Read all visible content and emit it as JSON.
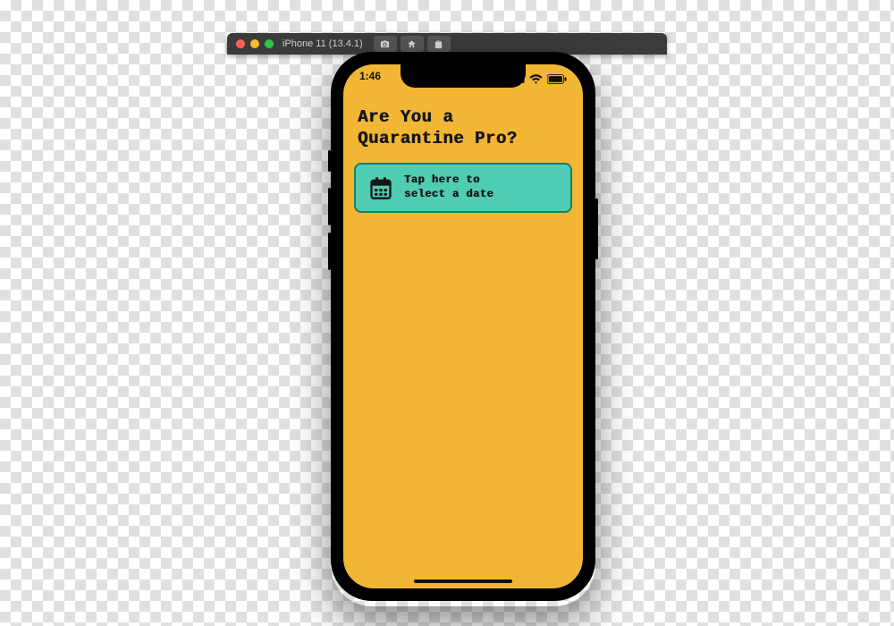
{
  "simulator": {
    "title": "iPhone 11 (13.4.1)",
    "buttons": {
      "screenshot": "screenshot-icon",
      "home": "home-icon",
      "clipboard": "clipboard-icon"
    }
  },
  "status": {
    "time": "1:46"
  },
  "app": {
    "title": "Are You a\nQuarantine Pro?",
    "date_button_label": "Tap here to\nselect a date"
  },
  "colors": {
    "screen_bg": "#f1b634",
    "button_bg": "#4fccb1",
    "button_border": "#177f6c"
  }
}
